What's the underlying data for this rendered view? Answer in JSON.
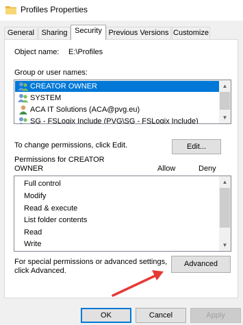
{
  "window": {
    "title": "Profiles Properties",
    "icon": "folder-icon"
  },
  "tabs": [
    {
      "label": "General",
      "active": false
    },
    {
      "label": "Sharing",
      "active": false
    },
    {
      "label": "Security",
      "active": true
    },
    {
      "label": "Previous Versions",
      "active": false
    },
    {
      "label": "Customize",
      "active": false
    }
  ],
  "security": {
    "object_name_label": "Object name:",
    "object_name_value": "E:\\Profiles",
    "group_label": "Group or user names:",
    "groups": [
      {
        "name": "CREATOR OWNER",
        "icon": "users-icon",
        "selected": true
      },
      {
        "name": "SYSTEM",
        "icon": "users-icon",
        "selected": false
      },
      {
        "name": "ACA IT Solutions (ACA@pvg.eu)",
        "icon": "user-icon",
        "selected": false
      },
      {
        "name": "SG - FSLogix Include (PVG\\SG - FSLogix Include)",
        "icon": "users-icon",
        "selected": false
      }
    ],
    "change_text": "To change permissions, click Edit.",
    "edit_label": "Edit...",
    "permissions_label_line1": "Permissions for CREATOR",
    "permissions_label_line2": "OWNER",
    "allow_header": "Allow",
    "deny_header": "Deny",
    "permissions": [
      {
        "name": "Full control"
      },
      {
        "name": "Modify"
      },
      {
        "name": "Read & execute"
      },
      {
        "name": "List folder contents"
      },
      {
        "name": "Read"
      },
      {
        "name": "Write"
      }
    ],
    "special_text_line1": "For special permissions or advanced settings,",
    "special_text_line2": "click Advanced.",
    "advanced_label": "Advanced"
  },
  "footer": {
    "ok_label": "OK",
    "cancel_label": "Cancel",
    "apply_label": "Apply"
  },
  "colors": {
    "selection": "#0078d7",
    "arrow": "#e53935"
  }
}
